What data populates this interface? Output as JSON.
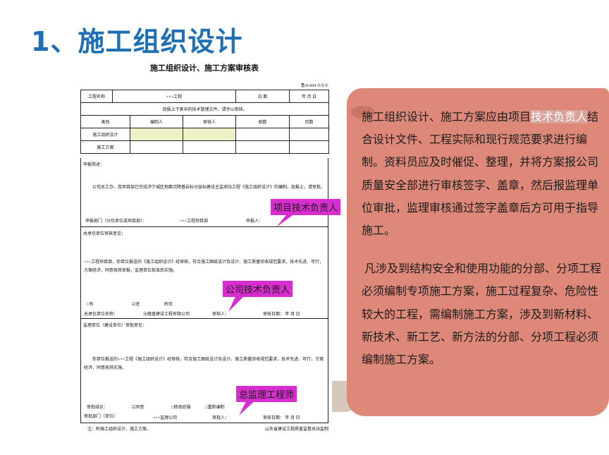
{
  "slide": {
    "title": "1、施工组织设计"
  },
  "form": {
    "title": "施工组织设计、施工方案审核表",
    "code": "鲁JJ-004 ①①①",
    "project_label": "工程名称",
    "project_value": "×××工程",
    "date_label": "日  期",
    "date_value": "年   月   日",
    "submit_note": "现报上下表中的技术管理文件，请予以审核。",
    "headers": [
      "类别",
      "编制人",
      "审核人",
      "册数",
      "页数"
    ],
    "rows": [
      "施工组织设计",
      "施工方案"
    ],
    "section1": {
      "title": "申报简述：",
      "body": "公司总工办、我项目部已完成济宁城区地面沉降基岩标分层标建设主监测站工程《施工组织设计》的编制，现报上，请审批。",
      "dept": "申报部门（分包单位或项目部）：",
      "dept_value": "×××工程项目部",
      "reporter": "申报人："
    },
    "section2": {
      "title": "总承包单位审核意见：",
      "body": "×××工程项目部，你单位报送的《施工组织设计》经审核，符合施工图纸设计及设计、施工质量验收规范要求，技术先进、可行，方案经济，同意按其审报，监理单位批准后实施。",
      "checks": [
        "□有",
        "☑无",
        "附页"
      ],
      "unit": "总承包单位名称：",
      "unit_value": "元隆盛建设工程有限公司",
      "auditor": "审核人：",
      "audit_date": "审核日期：    年   月   日"
    },
    "section3": {
      "title": "监理单位（建设单位）审批意见：",
      "body": "你单位报送的×××工程《施工组织设计》经审核，符合施工图纸设计及设计、施工质量验收规范要求，技术先进、可行，方案经济，同意按其实施。",
      "conclusion": "审批结论：",
      "options": [
        "☑同意",
        "□修改后报",
        "□重新编制"
      ],
      "dept": "审批部门（单位）",
      "dept_value": "×××监理公司",
      "approver": "审批人：",
      "approve_date": "审核日期：    年   月   日"
    },
    "footnote": "注：附施工组织设计、施工方案。",
    "org": "山东省建设工程质量监督总站监制"
  },
  "callouts": {
    "project_tech": "项目技术负责人",
    "company_tech": "公司技术负责人",
    "chief_supervisor": "总监理工程师"
  },
  "panel": {
    "p1_before": "施工组织设计、施工方案应由项目",
    "p1_highlight": "技术负责人",
    "p1_after": "结合设计文件、工程实际和现行规范要求进行编制。资料员应及时催促、整理，并将方案报公司质量安全部进行审核签字、盖章，然后报监理单位审批，监理审核通过签字盖章后方可用于指导施工。",
    "p2": "凡涉及到结构安全和使用功能的分部、分项工程必须编制专项施工方案，施工过程复杂、危险性较大的工程，需编制施工方案，涉及到新材料、新技术、新工艺、新方法的分部、分项工程必须编制施工方案。"
  },
  "colors": {
    "title": "#1f6fb4",
    "panel": "#dd8878",
    "callout": "#d82ed0",
    "cell_highlight": "#eef1c8"
  }
}
